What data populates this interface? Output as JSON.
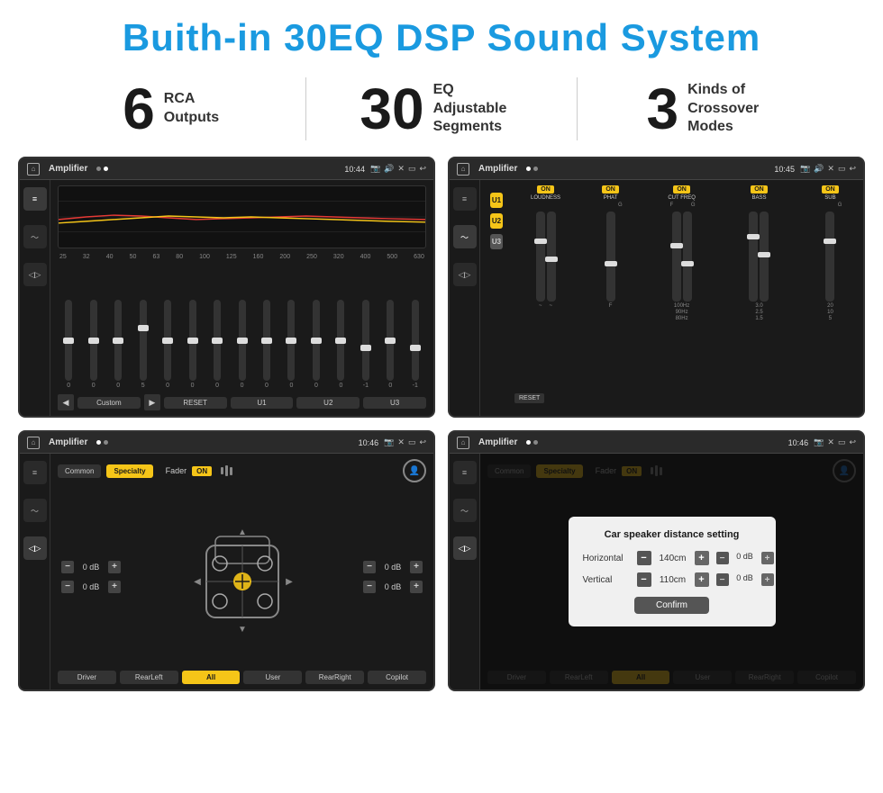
{
  "header": {
    "title": "Buith-in 30EQ DSP Sound System"
  },
  "stats": [
    {
      "number": "6",
      "text": "RCA\nOutputs"
    },
    {
      "number": "30",
      "text": "EQ Adjustable\nSegments"
    },
    {
      "number": "3",
      "text": "Kinds of\nCrossover Modes"
    }
  ],
  "screens": [
    {
      "id": "eq",
      "topbar": {
        "home": "⌂",
        "title": "Amplifier",
        "dots": [
          "inactive",
          "active"
        ],
        "time": "10:44"
      }
    },
    {
      "id": "crossover",
      "topbar": {
        "home": "⌂",
        "title": "Amplifier",
        "time": "10:45"
      }
    },
    {
      "id": "fader",
      "topbar": {
        "home": "⌂",
        "title": "Amplifier",
        "time": "10:46"
      },
      "modes": [
        "Common",
        "Specialty"
      ],
      "fader_label": "Fader",
      "fader_on": "ON",
      "speaker_values": [
        "0 dB",
        "0 dB",
        "0 dB",
        "0 dB"
      ],
      "bottom_btns": [
        "Driver",
        "RearLeft",
        "All",
        "User",
        "RearRight",
        "Copilot"
      ]
    },
    {
      "id": "fader-dialog",
      "topbar": {
        "home": "⌂",
        "title": "Amplifier",
        "time": "10:46"
      },
      "modes": [
        "Common",
        "Specialty"
      ],
      "dialog": {
        "title": "Car speaker distance setting",
        "horizontal_label": "Horizontal",
        "horizontal_value": "140cm",
        "vertical_label": "Vertical",
        "vertical_value": "110cm",
        "confirm_label": "Confirm"
      },
      "bottom_btns": [
        "Driver",
        "RearLeft",
        "All",
        "User",
        "RearRight",
        "Copilot"
      ],
      "speaker_values": [
        "0 dB",
        "0 dB"
      ]
    }
  ],
  "eq_freqs": [
    "25",
    "32",
    "40",
    "50",
    "63",
    "80",
    "100",
    "125",
    "160",
    "200",
    "250",
    "320",
    "400",
    "500",
    "630"
  ],
  "eq_values": [
    "0",
    "0",
    "0",
    "5",
    "0",
    "0",
    "0",
    "0",
    "0",
    "0",
    "0",
    "0",
    "-1",
    "0",
    "-1"
  ],
  "eq_presets": [
    "Custom",
    "RESET",
    "U1",
    "U2",
    "U3"
  ],
  "crossover_presets": [
    "U1",
    "U2",
    "U3"
  ],
  "crossover_channels": [
    "LOUDNESS",
    "PHAT",
    "CUT FREQ",
    "BASS",
    "SUB"
  ],
  "dialog": {
    "confirm": "Confirm"
  }
}
